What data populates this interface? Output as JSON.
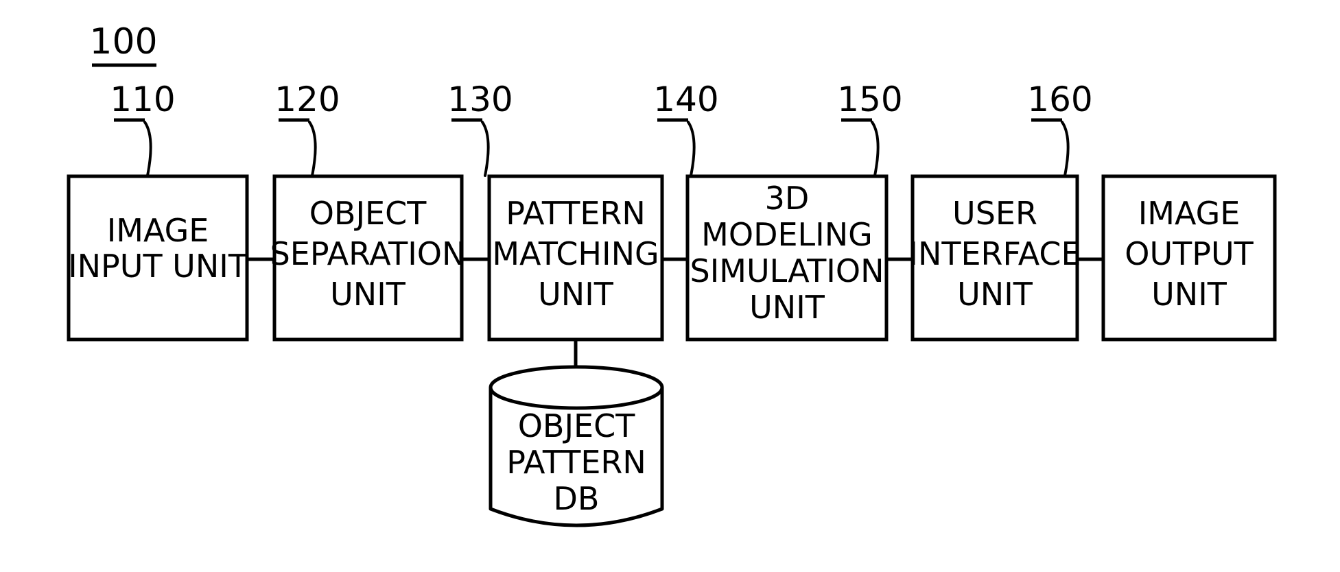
{
  "figure": {
    "number": "100",
    "type": "patent-block-diagram"
  },
  "blocks": [
    {
      "ref": "110",
      "name": "image-input-unit",
      "lines": [
        "IMAGE",
        "INPUT UNIT"
      ],
      "line1": "IMAGE",
      "line2": "INPUT UNIT",
      "line3": "",
      "line4": ""
    },
    {
      "ref": "120",
      "name": "object-separation-unit",
      "lines": [
        "OBJECT",
        "SEPARATION",
        "UNIT"
      ],
      "line1": "OBJECT",
      "line2": "SEPARATION",
      "line3": "UNIT",
      "line4": ""
    },
    {
      "ref": "130",
      "name": "pattern-matching-unit",
      "lines": [
        "PATTERN",
        "MATCHING",
        "UNIT"
      ],
      "line1": "PATTERN",
      "line2": "MATCHING",
      "line3": "UNIT",
      "line4": ""
    },
    {
      "ref": "140",
      "name": "3d-modeling-simulation-unit",
      "lines": [
        "3D",
        "MODELING",
        "SIMULATION",
        "UNIT"
      ],
      "line1": "3D",
      "line2": "MODELING",
      "line3": "SIMULATION",
      "line4": "UNIT"
    },
    {
      "ref": "150",
      "name": "user-interface-unit",
      "lines": [
        "USER",
        "INTERFACE",
        "UNIT"
      ],
      "line1": "USER",
      "line2": "INTERFACE",
      "line3": "UNIT",
      "line4": ""
    },
    {
      "ref": "160",
      "name": "image-output-unit",
      "lines": [
        "IMAGE",
        "OUTPUT",
        "UNIT"
      ],
      "line1": "IMAGE",
      "line2": "OUTPUT",
      "line3": "UNIT",
      "line4": ""
    }
  ],
  "database": {
    "name": "object-pattern-db",
    "lines": [
      "OBJECT",
      "PATTERN",
      "DB"
    ],
    "line1": "OBJECT",
    "line2": "PATTERN",
    "line3": "DB"
  },
  "colors": {
    "stroke": "#000000",
    "background": "#ffffff"
  }
}
